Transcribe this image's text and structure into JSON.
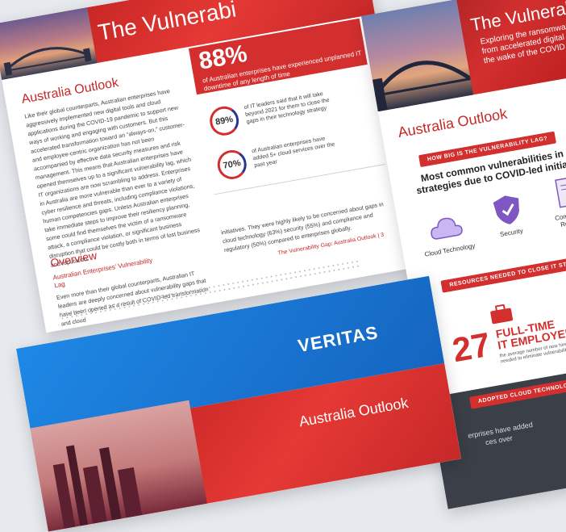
{
  "left_page": {
    "banner_title": "The Vulnerabi",
    "section_title": "Australia Outlook",
    "body": "Like their global counterparts, Australian enterprises have aggressively implemented new digital tools and cloud applications during the COVID-19 pandemic to support new ways of working and engaging with customers. But this accelerated transformation toward an “always-on,” customer- and employee-centric organization has not been accompanied by effective data security measures and risk management. This means that Australian enterprises have opened themselves up to a significant vulnerability lag, which IT organizations are now scrambling to address. Enterprises in Australia are more vulnerable than ever to a variety of cyber resilience and threats, including compliance violations, human competencies gaps. Unless Australian enterprises take immediate steps to improve their resiliency planning, some could find themselves the victim of a ransomware attack, a compliance violation, or significant business disruption that could be costly both in terms of lost business and reputation.",
    "stat_big": "88%",
    "stat_caption": "of Australian enterprises have experienced unplanned IT downtime of any length of time",
    "ring1_value": "89%",
    "ring1_text": "of IT leaders said that it will take beyond 2021 for them to close the gaps in their technology strategy",
    "ring2_value": "70%",
    "ring2_text": "of Australian enterprises have added 5+ cloud services over the past year",
    "overview_title": "Overview",
    "overview_sub": "Australian Enterprises’ Vulnerability Lag",
    "overview_text": "Even more than their global counterparts, Australian IT leaders are deeply concerned about vulnerability gaps that have been opened as a result of COVID-led transformation and cloud",
    "overview_text2": "initiatives. They were highly likely to be concerned about gaps in cloud technology (63%) security (55%) and compliance and regulatory (50%) compared to enterprises globally.",
    "footer": "The Vulnerability Gap: Australia Outlook | 3"
  },
  "right_page": {
    "banner_title": "The Vulnerab",
    "banner_sub_1": "Exploring the ransomware",
    "banner_sub_2": "from accelerated digital tr",
    "banner_sub_3": "the wake of the COVID pa",
    "section_title": "Australia Outlook",
    "pill_1": "HOW BIG IS THE VULNERABILITY LAG?",
    "heading_1": "Most common vulnerabilities in IT",
    "heading_2": "strategies due to COVID-led initiatives",
    "icon_cloud_label": "Cloud Technology",
    "icon_security_label": "Security",
    "icon_compliance_label": "Compliance & Regulatory",
    "pill_2": "RESOURCES NEEDED TO CLOSE IT STRATEGY GAPS WI",
    "big_number": "27",
    "fte_1": "FULL-TIME",
    "fte_2": "IT EMPLOYEES",
    "fte_sub": "the average number of new hires needed to eliminate vulnerabilities",
    "purple_text": "$",
    "pill_3": "ADOPTED CLOUD TECHNOLOGIES",
    "dark_text_1": "erprises have added",
    "dark_text_2": "ces over"
  },
  "bottom_page": {
    "logo": "VERITAS",
    "title_1": "Australia Outlook"
  },
  "colors": {
    "accent_red": "#d32f2f",
    "ring_blue": "#283593",
    "purple": "#8e24aa"
  }
}
